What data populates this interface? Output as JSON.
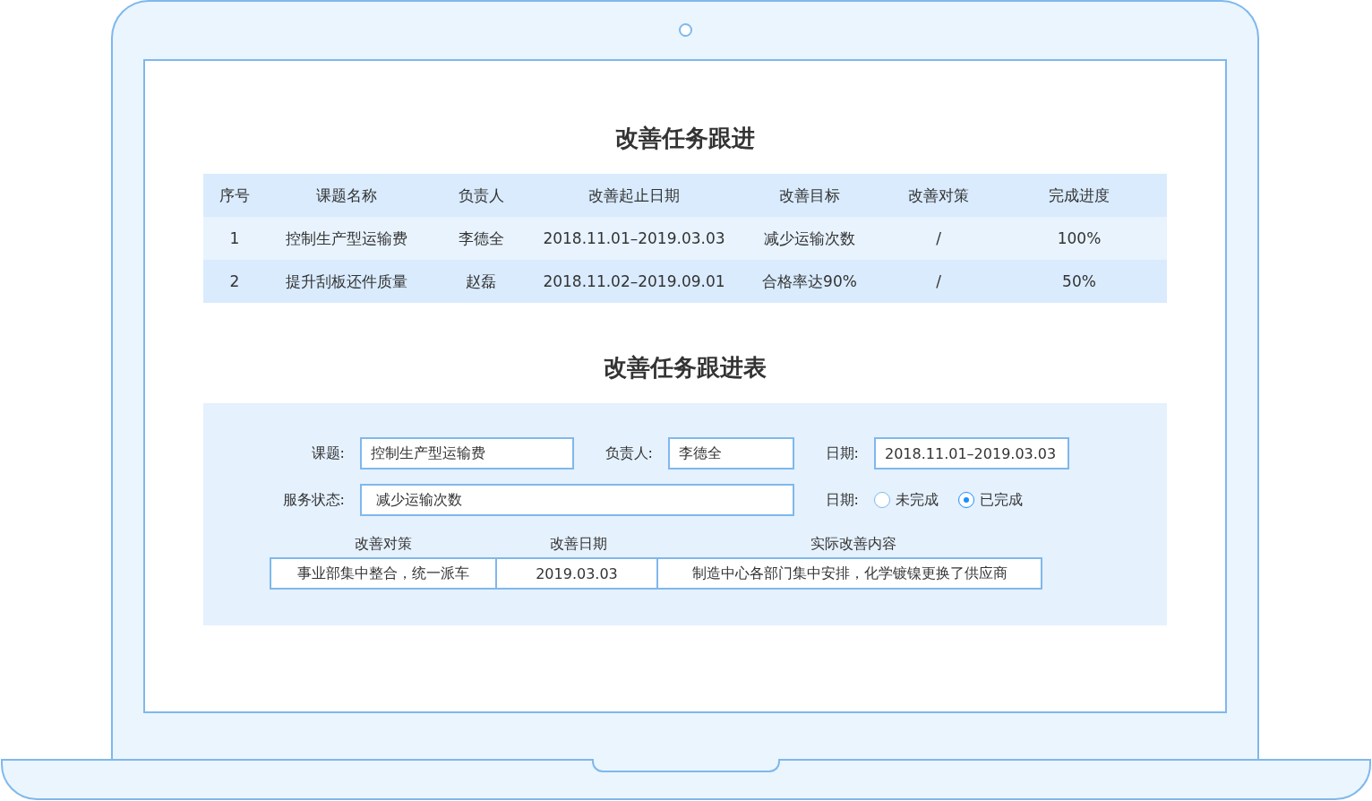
{
  "table": {
    "title": "改善任务跟进",
    "columns": [
      "序号",
      "课题名称",
      "负责人",
      "改善起止日期",
      "改善目标",
      "改善对策",
      "完成进度"
    ],
    "rows": [
      [
        "1",
        "控制生产型运输费",
        "李德全",
        "2018.11.01–2019.03.03",
        "减少运输次数",
        "/",
        "100%"
      ],
      [
        "2",
        "提升刮板还件质量",
        "赵磊",
        "2018.11.02–2019.09.01",
        "合格率达90%",
        "/",
        "50%"
      ]
    ]
  },
  "form": {
    "title": "改善任务跟进表",
    "rows": [
      [
        {
          "kind": "text",
          "label": "课题:",
          "value": "控制生产型运输费"
        },
        {
          "kind": "text",
          "label": "负责人:",
          "value": "李德全"
        },
        {
          "kind": "text",
          "label": "日期:",
          "value": "2018.11.01–2019.03.03"
        }
      ],
      [
        {
          "kind": "text",
          "label": "服务状态:",
          "value": "减少运输次数"
        },
        "",
        {
          "kind": "radio",
          "label": "日期:",
          "options": [
            {
              "label": "未完成",
              "selected": false
            },
            {
              "label": "已完成",
              "selected": true
            }
          ]
        }
      ]
    ],
    "measures": {
      "columns": [
        "改善对策",
        "改善日期",
        "实际改善内容"
      ],
      "cells": [
        "事业部集中整合，统一派车",
        "2019.03.03",
        "制造中心各部门集中安排，化学镀镍更换了供应商"
      ]
    }
  }
}
